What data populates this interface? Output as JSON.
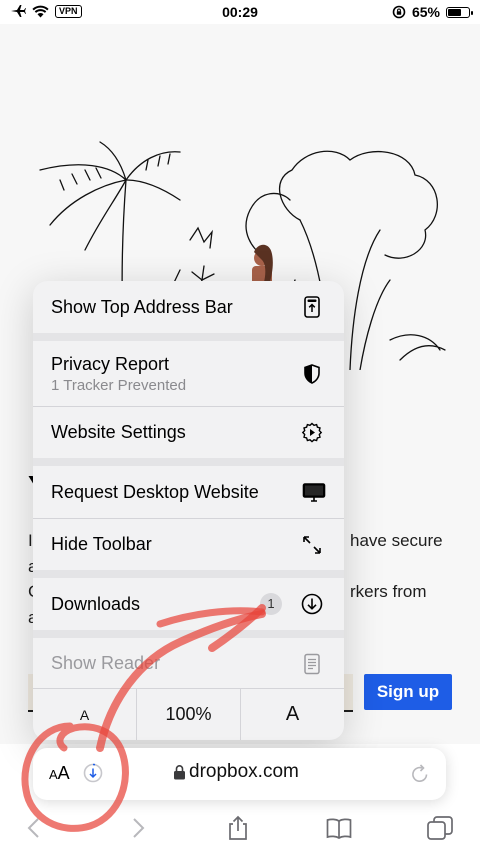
{
  "status_bar": {
    "vpn": "VPN",
    "time": "00:29",
    "battery": "65%",
    "battery_level": 0.65,
    "icons": [
      "airplane-icon",
      "wifi-icon",
      "orientation-lock-icon",
      "battery-icon"
    ]
  },
  "page": {
    "heading_fragment": "Y",
    "line1_left": "I",
    "line1_right": "have secure",
    "line2_left": "a",
    "line3_left": "C",
    "line3_right": "rkers from",
    "line4_left": "a",
    "email_placeholder": "",
    "signup_label": "Sign up"
  },
  "menu": {
    "items": [
      {
        "label": "Show Top Address Bar",
        "icon": "top-address-bar-icon"
      },
      {
        "label": "Privacy Report",
        "sublabel": "1 Tracker Prevented",
        "icon": "privacy-shield-icon"
      },
      {
        "label": "Website Settings",
        "icon": "website-settings-icon"
      },
      {
        "label": "Request Desktop Website",
        "icon": "desktop-icon"
      },
      {
        "label": "Hide Toolbar",
        "icon": "expand-arrows-icon"
      },
      {
        "label": "Downloads",
        "badge": "1",
        "icon": "download-icon"
      },
      {
        "label": "Show Reader",
        "icon": "reader-icon",
        "disabled": true
      }
    ],
    "zoom": {
      "decrease": "A",
      "level": "100%",
      "increase": "A"
    }
  },
  "address_bar": {
    "aa_small": "A",
    "aa_large": "A",
    "url": "dropbox.com"
  },
  "toolbar": {
    "icons": [
      "back-icon",
      "forward-icon",
      "share-icon",
      "bookmarks-icon",
      "tabs-icon"
    ]
  },
  "colors": {
    "accent": "#1e5de6",
    "annotation": "#e8453c",
    "menu_bg": "#f2f2f3",
    "separator": "#e4e4e6"
  }
}
